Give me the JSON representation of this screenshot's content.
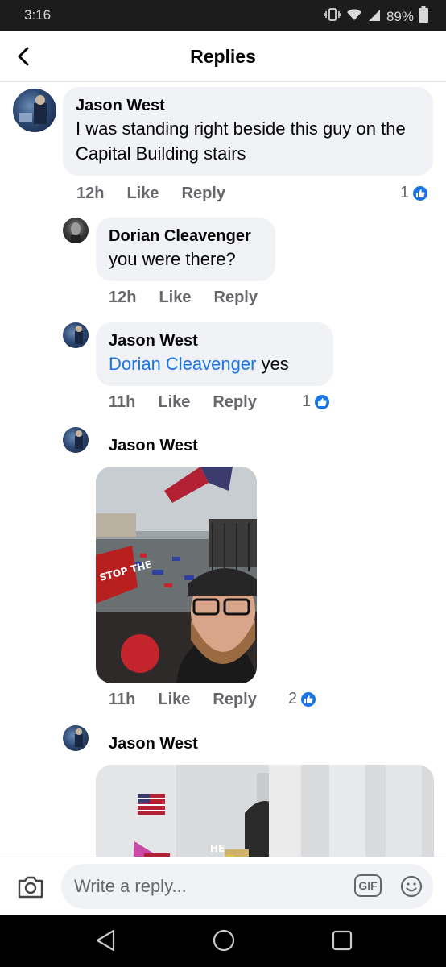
{
  "status_bar": {
    "time": "3:16",
    "battery": "89%"
  },
  "header": {
    "title": "Replies"
  },
  "comments": [
    {
      "author": "Jason West",
      "text": "I was standing right beside this guy on the Capital Building stairs",
      "time": "12h",
      "like_label": "Like",
      "reply_label": "Reply",
      "reactions": "1"
    },
    {
      "author": "Dorian Cleavenger",
      "text": "you were there?",
      "time": "12h",
      "like_label": "Like",
      "reply_label": "Reply"
    },
    {
      "author": "Jason West",
      "mention": "Dorian Cleavenger",
      "text": "yes",
      "time": "11h",
      "like_label": "Like",
      "reply_label": "Reply",
      "reactions": "1"
    },
    {
      "author": "Jason West",
      "photo": "selfie",
      "photo_sign_text": "STOP THE",
      "time": "11h",
      "like_label": "Like",
      "reply_label": "Reply",
      "reactions": "2"
    },
    {
      "author": "Jason West",
      "photo": "capitol-columns",
      "photo_sign_text": "HE"
    }
  ],
  "composer": {
    "placeholder": "Write a reply...",
    "gif_label": "GIF"
  },
  "icons": {
    "back": "chevron-left-icon",
    "camera": "camera-icon",
    "emoji": "smiley-icon",
    "like": "thumbs-up-icon",
    "nav_back": "triangle-back-icon",
    "nav_home": "circle-home-icon",
    "nav_recent": "square-recent-icon"
  },
  "colors": {
    "accent": "#1b74e4",
    "bubble": "#f0f2f5",
    "muted": "#65676b"
  }
}
